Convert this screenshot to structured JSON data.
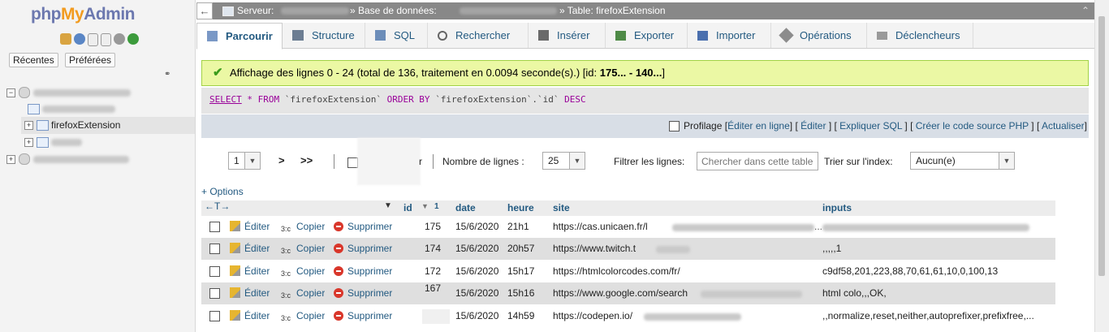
{
  "sidebar": {
    "logo_php": "php",
    "logo_my": "My",
    "logo_admin": "Admin",
    "recent_label": "Récentes",
    "favorites_label": "Préférées",
    "selected_table": "firefoxExtension"
  },
  "breadcrumb": {
    "server_label": "Serveur:",
    "database_label": "» Base de données:",
    "table_label": "» Table: firefoxExtension"
  },
  "tabs": [
    {
      "label": "Parcourir"
    },
    {
      "label": "Structure"
    },
    {
      "label": "SQL"
    },
    {
      "label": "Rechercher"
    },
    {
      "label": "Insérer"
    },
    {
      "label": "Exporter"
    },
    {
      "label": "Importer"
    },
    {
      "label": "Opérations"
    },
    {
      "label": "Déclencheurs"
    }
  ],
  "message": {
    "text_before": "Affichage des lignes 0 - 24 (total de 136, traitement en 0.0094 seconde(s).) [id: ",
    "id_range": "175... - 140...",
    "text_after": "]"
  },
  "sql": {
    "select": "SELECT",
    "star_from": " * FROM ",
    "table": "`firefoxExtension`",
    "order_by": " ORDER BY ",
    "column": "`firefoxExtension`.`id`",
    "desc": " DESC"
  },
  "tools": {
    "profiling": "Profilage",
    "edit_inline": "Éditer en ligne",
    "edit": "Éditer",
    "explain": "Expliquer SQL",
    "php_code": "Créer le code source PHP",
    "refresh": "Actualiser"
  },
  "navigation": {
    "page_value": "1",
    "next": ">",
    "last": ">>",
    "show_all_suffix": "r",
    "rows_label": "Nombre de lignes :",
    "rows_value": "25",
    "filter_label": "Filtrer les lignes:",
    "filter_placeholder": "Chercher dans cette table",
    "sort_label": "Trier sur l'index:",
    "sort_value": "Aucun(e)"
  },
  "options_label": "+ Options",
  "table": {
    "headers": {
      "id": "id",
      "sort_indicator": "1",
      "date": "date",
      "heure": "heure",
      "site": "site",
      "inputs": "inputs"
    },
    "action_labels": {
      "edit": "Éditer",
      "copy": "Copier",
      "delete": "Supprimer"
    },
    "rows": [
      {
        "id": "175",
        "date": "15/6/2020",
        "heure": "21h1",
        "site": "https://cas.unicaen.fr/l",
        "inputs": ""
      },
      {
        "id": "174",
        "date": "15/6/2020",
        "heure": "20h57",
        "site": "https://www.twitch.t",
        "inputs": ",,,,,1"
      },
      {
        "id": "172",
        "date": "15/6/2020",
        "heure": "15h17",
        "site": "https://htmlcolorcodes.com/fr/",
        "inputs": "c9df58,201,223,88,70,61,61,10,0,100,13"
      },
      {
        "id": "167",
        "date": "15/6/2020",
        "heure": "15h16",
        "site": "https://www.google.com/search",
        "inputs": "html colo,,,OK,"
      },
      {
        "id": "",
        "date": "15/6/2020",
        "heure": "14h59",
        "site": "https://codepen.io/",
        "inputs": ",,normalize,reset,neither,autoprefixer,prefixfree,..."
      }
    ]
  },
  "colors": {
    "link": "#235a81",
    "success_bg": "#ebf8a4",
    "breadcrumb_bg": "#888888",
    "row_alt": "#dfdfdf"
  }
}
